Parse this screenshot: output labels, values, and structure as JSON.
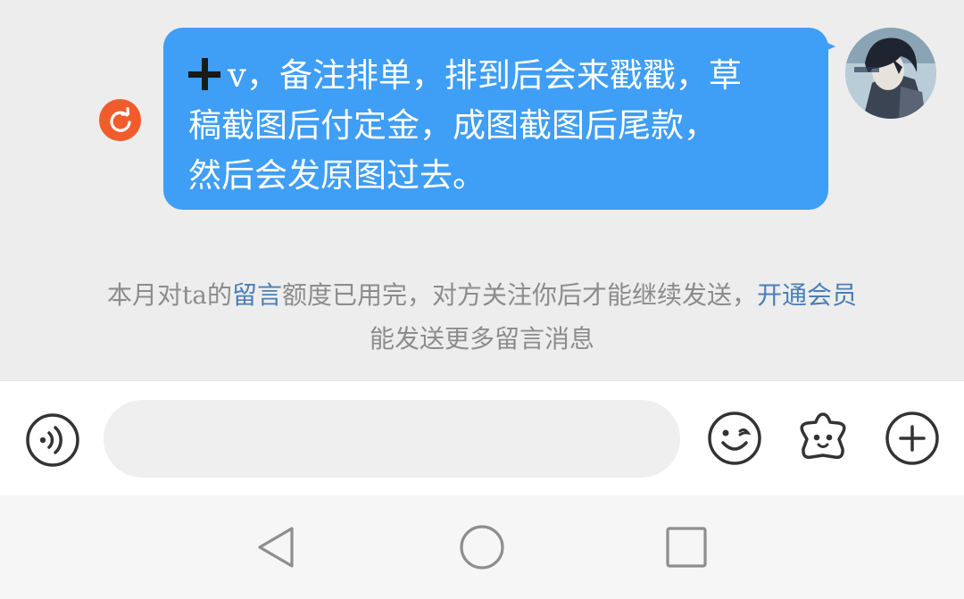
{
  "message": {
    "line1": "v，备注排单，排到后会来戳戳，草",
    "line2": "稿截图后付定金，成图截图后尾款，",
    "line3": "然后会发原图过去。",
    "bubble_color": "#3f9ef5",
    "status": "failed-resend-icon"
  },
  "notice": {
    "part1": "本月对ta的",
    "link1": "留言",
    "part2": "额度已用完，对方关注你后才能继续发送，",
    "link2": "开通会员",
    "part3": "能发送更多留言消息"
  },
  "input_bar": {
    "value": "",
    "icons": [
      "voice-icon",
      "emoji-icon",
      "sticker-icon",
      "plus-icon"
    ]
  },
  "nav": {
    "icons": [
      "back-triangle-icon",
      "home-circle-icon",
      "recent-square-icon"
    ]
  },
  "colors": {
    "background": "#ededed",
    "link": "#4a7fb6",
    "resend": "#f05c2c"
  }
}
